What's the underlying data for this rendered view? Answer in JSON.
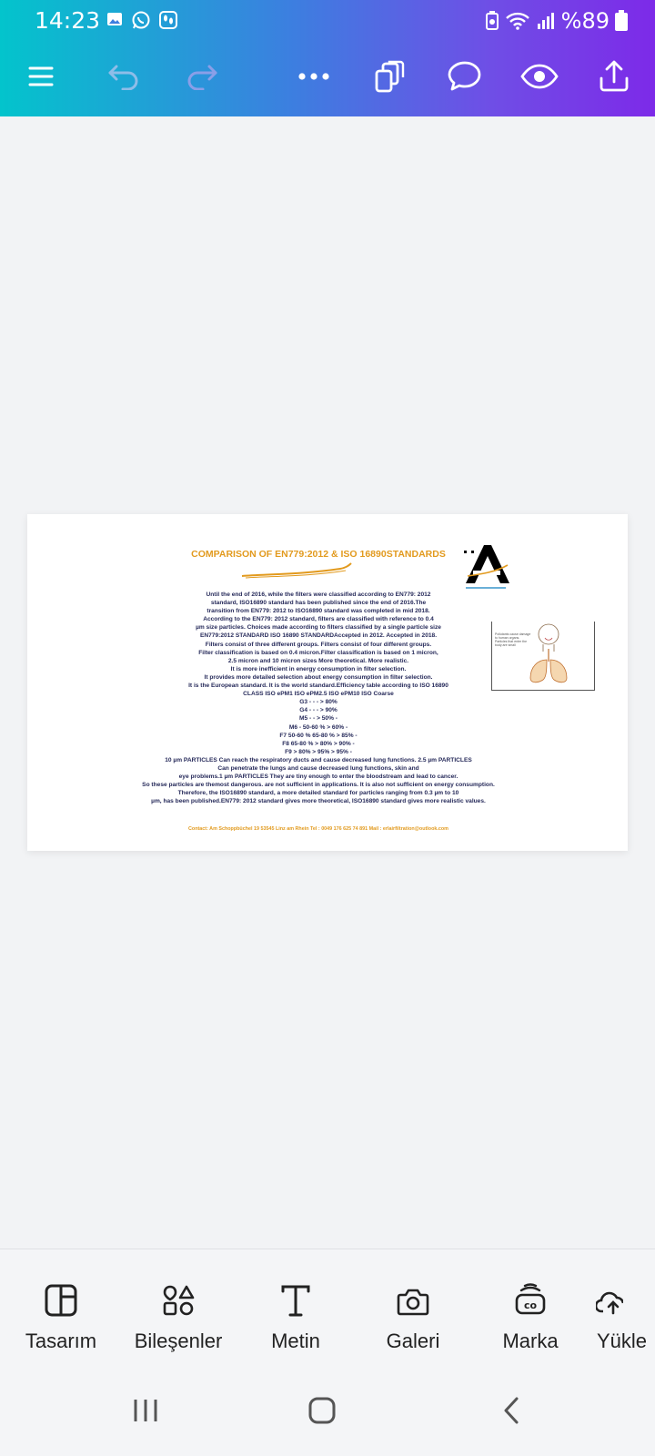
{
  "status": {
    "time": "14:23",
    "battery": "%89",
    "left_icons": [
      "gallery-icon",
      "whatsapp-icon",
      "footprint-icon"
    ],
    "right_icons": [
      "battery-saver-icon",
      "wifi-icon",
      "signal-icon",
      "battery-icon"
    ]
  },
  "toolbar": {
    "icons": [
      "menu-icon",
      "undo-icon",
      "redo-icon",
      "more-icon",
      "pages-icon",
      "comment-icon",
      "preview-icon",
      "share-icon"
    ]
  },
  "document": {
    "title": "COMPARISON OF EN779:2012 & ISO 16890STANDARDS",
    "body_lines": [
      "Until the end of 2016, while the filters were classified according to EN779: 2012",
      "standard, ISO16890 standard has been published since the end of 2016.The",
      "transition from EN779: 2012 to ISO16890 standard was completed in mid 2018.",
      "According to the EN779: 2012 standard, filters are classified with reference to 0.4",
      "µm size particles. Choices made according to filters classified by a single particle size",
      "EN779:2012 STANDARD ISO 16890 STANDARDAccepted in 2012. Accepted in 2018.",
      "Filters consist of three different groups. Filters consist of four different groups.",
      "Filter classification is based on 0.4 micron.Filter classification is based on 1 micron,",
      "2.5 micron and 10 micron sizes More theoretical. More realistic.",
      "It is more inefficient in energy consumption in filter selection.",
      "It provides more detailed selection about energy consumption in filter selection.",
      "It is the European standard. It is the world standard.Efficiency table according to ISO 16890",
      "CLASS ISO ePM1 ISO ePM2.5 ISO ePM10 ISO Coarse",
      "G3 - - - > 80%",
      "G4 - - - > 90%",
      "M5 - - > 50% -",
      "M6 - 50-60 % > 60% -",
      "F7 50-60 % 65-80 % > 85% -",
      "F8 65-80 % > 80% > 90% -",
      "F9 > 80% > 95% > 95% -",
      "10 µm PARTICLES Can reach the respiratory ducts and cause decreased lung functions. 2.5 µm PARTICLES",
      "Can penetrate the lungs and cause decreased lung functions, skin and",
      "eye problems.1 µm PARTICLES They are tiny enough to enter the bloodstream and lead to cancer.",
      "So these particles are themost dangerous. are not sufficient in applications. It is also not sufficient on energy consumption.",
      "Therefore, the ISO16890 standard, a more detailed standard for particles ranging from 0.3 µm to 10",
      "µm, has been published.EN779: 2012 standard gives more theoretical, ISO16890 standard gives more realistic  values."
    ],
    "contact": "Contact: Am Schoppbüchel 19 53545 Linz am Rhein    Tel : 0049 176 625 74 891  Mail : erlairfiltration@outlook.com",
    "logo_text": "ERL AIR filtration",
    "image_caption": "Pollutants cause damage to human organs. Particles that enter the body are small"
  },
  "bottom_tools": [
    {
      "label": "Tasarım",
      "icon": "design-icon"
    },
    {
      "label": "Bileşenler",
      "icon": "elements-icon"
    },
    {
      "label": "Metin",
      "icon": "text-icon"
    },
    {
      "label": "Galeri",
      "icon": "camera-icon"
    },
    {
      "label": "Marka",
      "icon": "brand-icon"
    },
    {
      "label": "Yükle",
      "icon": "upload-icon"
    }
  ],
  "nav": [
    "recent-apps-icon",
    "home-icon",
    "back-icon"
  ]
}
